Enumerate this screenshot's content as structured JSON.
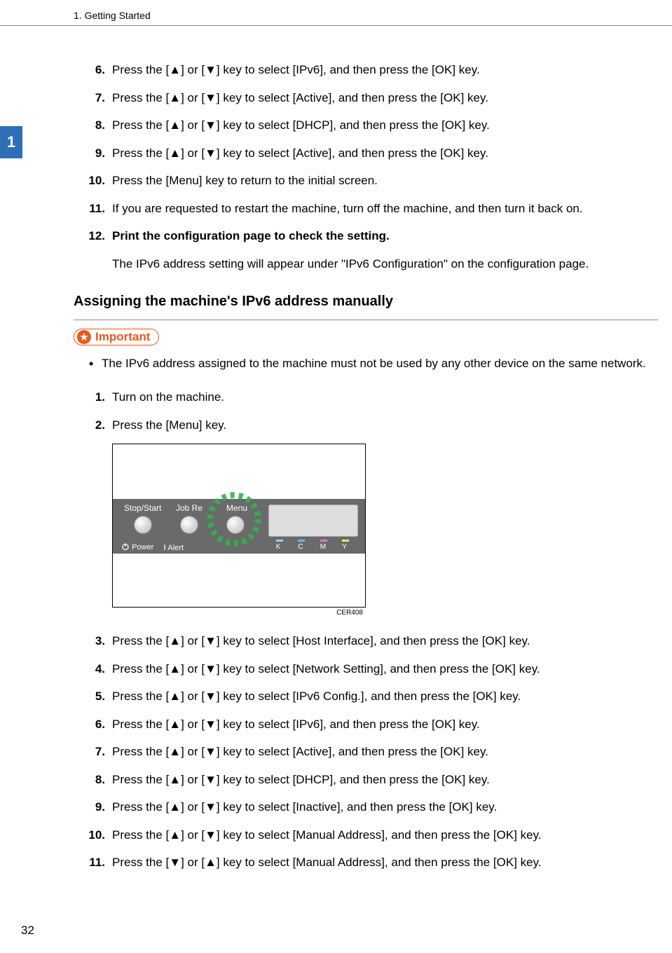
{
  "header": {
    "chapter": "1. Getting Started"
  },
  "side_tab": "1",
  "page_number": "32",
  "steps_a": [
    {
      "n": "6.",
      "text": "Press the [▲] or [▼] key to select [IPv6], and then press the [OK] key."
    },
    {
      "n": "7.",
      "text": "Press the [▲] or [▼] key to select [Active], and then press the [OK] key."
    },
    {
      "n": "8.",
      "text": "Press the [▲] or [▼] key to select [DHCP], and then press the [OK] key."
    },
    {
      "n": "9.",
      "text": "Press the [▲] or [▼] key to select [Active], and then press the [OK] key."
    },
    {
      "n": "10.",
      "text": "Press the [Menu] key to return to the initial screen."
    },
    {
      "n": "11.",
      "text": "If you are requested to restart the machine, turn off the machine, and then turn it back on."
    },
    {
      "n": "12.",
      "text": "Print the configuration page to check the setting.",
      "note": "The IPv6 address setting will appear under \"IPv6 Configuration\" on the configuration page."
    }
  ],
  "section_title": "Assigning the machine's IPv6 address manually",
  "important": {
    "label": "Important",
    "bullet": "The IPv6 address assigned to the machine must not be used by any other device on the same network."
  },
  "steps_b_pre": [
    {
      "n": "1.",
      "text": "Turn on the machine."
    },
    {
      "n": "2.",
      "text": "Press the [Menu] key."
    }
  ],
  "figure": {
    "stop_start": "Stop/Start",
    "job_reset": "Job Re",
    "menu": "Menu",
    "power": "Power",
    "alert": "Alert",
    "ind": {
      "k": "K",
      "c": "C",
      "m": "M",
      "y": "Y"
    },
    "caption": "CER408"
  },
  "steps_b_post": [
    {
      "n": "3.",
      "text": "Press the [▲] or [▼] key to select [Host Interface], and then press the [OK] key."
    },
    {
      "n": "4.",
      "text": "Press the [▲] or [▼] key to select [Network Setting], and then press the [OK] key."
    },
    {
      "n": "5.",
      "text": "Press the [▲] or [▼] key to select [IPv6 Config.], and then press the [OK] key."
    },
    {
      "n": "6.",
      "text": "Press the [▲] or [▼] key to select [IPv6], and then press the [OK] key."
    },
    {
      "n": "7.",
      "text": "Press the [▲] or [▼] key to select [Active], and then press the [OK] key."
    },
    {
      "n": "8.",
      "text": "Press the [▲] or [▼] key to select [DHCP], and then press the [OK] key."
    },
    {
      "n": "9.",
      "text": "Press the [▲] or [▼] key to select [Inactive], and then press the [OK] key."
    },
    {
      "n": "10.",
      "text": "Press the [▲] or [▼] key to select [Manual Address], and then press the [OK] key."
    },
    {
      "n": "11.",
      "text": "Press the [▼] or [▲] key to select [Manual Address], and then press the [OK] key."
    }
  ]
}
